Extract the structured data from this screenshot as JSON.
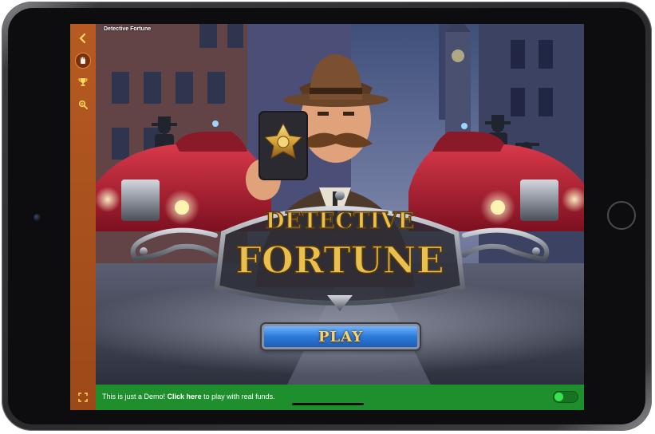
{
  "game": {
    "title": "Detective Fortune",
    "logo_line1": "DETECTIVE",
    "logo_line2": "FORTUNE",
    "play_label": "PLAY"
  },
  "sidebar": {
    "icons": [
      "back-chevron-icon",
      "stop-hand-icon",
      "trophy-icon",
      "search-icon"
    ]
  },
  "demo_bar": {
    "prefix": "This is just a Demo!",
    "link": "Click here",
    "suffix": "to play with real funds.",
    "toggle_on": true
  },
  "colors": {
    "sidebar": "#b65a22",
    "demo_bar": "#1e8f2c",
    "toggle_knob": "#37e34d",
    "play_button": "#2c7ad8",
    "logo_gold": "#e9bf4e"
  }
}
